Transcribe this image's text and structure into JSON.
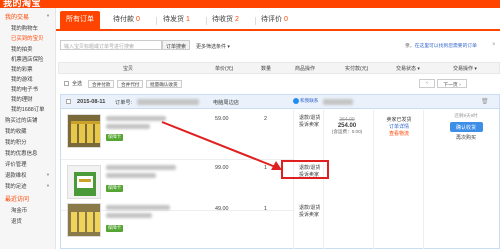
{
  "header": {
    "brand": "我的淘宝"
  },
  "sidebar": {
    "items": [
      {
        "label": "我的交易",
        "kind": "group"
      },
      {
        "label": "我的购物车",
        "kind": "item"
      },
      {
        "label": "已买到的宝贝",
        "kind": "active"
      },
      {
        "label": "我的拍卖",
        "kind": "item"
      },
      {
        "label": "机票酒店保险",
        "kind": "item"
      },
      {
        "label": "我的彩票",
        "kind": "item"
      },
      {
        "label": "我的游戏",
        "kind": "item"
      },
      {
        "label": "我的电子书",
        "kind": "item"
      },
      {
        "label": "我的理财",
        "kind": "item"
      },
      {
        "label": "我的1688订单",
        "kind": "item"
      },
      {
        "label": "购买过的店铺",
        "kind": "item"
      },
      {
        "label": "我的收藏",
        "kind": "item"
      },
      {
        "label": "我的积分",
        "kind": "item"
      },
      {
        "label": "我的优惠信息",
        "kind": "item"
      },
      {
        "label": "评价管理",
        "kind": "item"
      },
      {
        "label": "退款维权",
        "kind": "item"
      },
      {
        "label": "我的足迹",
        "kind": "item"
      },
      {
        "label": "最近访问",
        "kind": "group"
      },
      {
        "label": "淘金币",
        "kind": "item"
      },
      {
        "label": "退货",
        "kind": "item"
      }
    ]
  },
  "tabs": [
    {
      "label": "所有订单",
      "count": ""
    },
    {
      "label": "待付款",
      "count": "0"
    },
    {
      "label": "待发货",
      "count": "1"
    },
    {
      "label": "待收货",
      "count": "2"
    },
    {
      "label": "待评价",
      "count": "0"
    }
  ],
  "search": {
    "placeholder": "输入宝贝标题或订单号进行搜索",
    "button": "订单搜索",
    "more": "更多筛选条件"
  },
  "notice": {
    "text": "亲，",
    "link": "在这里可以找到您需要的订单"
  },
  "columns": [
    "宝贝",
    "单价(元)",
    "数量",
    "商品操作",
    "实付款(元)",
    "交易状态",
    "交易操作"
  ],
  "batch": {
    "select_all": "全选",
    "merge_pay": "合并付款",
    "merge_pay2": "合并代付",
    "batch_confirm": "批量确认收货",
    "prev": "上一页",
    "next": "下一页"
  },
  "order": {
    "date": "2015-08-11",
    "order_no_label": "订单号:",
    "shop_label": "电脑周边店",
    "chat_label": "和我联系",
    "items": [
      {
        "price": "59.00",
        "qty": "2",
        "badge": "保障卡",
        "ops": [
          "退款/退货",
          "投诉卖家"
        ]
      },
      {
        "price": "99.00",
        "qty": "1",
        "badge": "保障卡",
        "ops": [
          "退款/退货",
          "投诉卖家"
        ]
      },
      {
        "price": "49.00",
        "qty": "1",
        "badge": "保障卡",
        "ops": [
          "退款/退货",
          "投诉卖家"
        ]
      }
    ],
    "paid_old": "264.00",
    "paid_now": "254.00",
    "shipping": "(含运费：0.00)",
    "status_main": "卖家已发货",
    "status_detail": "订单详情",
    "status_logistics": "查看物流",
    "timer": "还剩9天9时",
    "confirm_btn": "确认收货",
    "extend": "再次购买"
  }
}
